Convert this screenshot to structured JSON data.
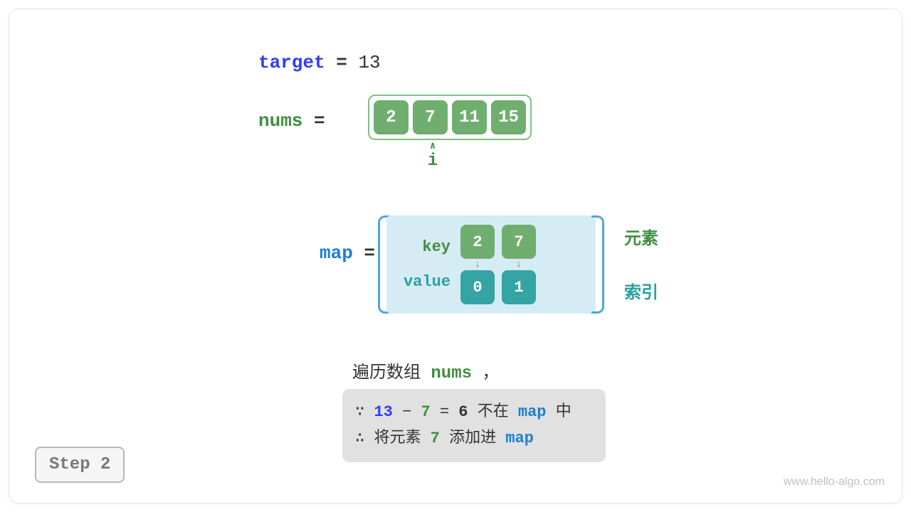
{
  "target": {
    "label": "target",
    "eq": "=",
    "value": "13"
  },
  "nums": {
    "label": "nums",
    "eq": "=",
    "items": [
      "2",
      "7",
      "11",
      "15"
    ],
    "pointer": {
      "index": 1,
      "symbol": "i"
    }
  },
  "map": {
    "label": "map",
    "eq": "=",
    "key_label": "key",
    "value_label": "value",
    "entries": [
      {
        "key": "2",
        "value": "0"
      },
      {
        "key": "7",
        "value": "1"
      }
    ],
    "side": {
      "key_desc": "元素",
      "value_desc": "索引"
    }
  },
  "desc": {
    "line1_pre": "遍历数组 ",
    "line1_var": "nums",
    "line1_post": " ，",
    "because": "∵",
    "therefore": "∴",
    "n1": "13",
    "minus": "−",
    "n2": "7",
    "eq": "=",
    "n3": "6",
    "notin_pre": " 不在 ",
    "map_word": "map",
    "notin_post": " 中",
    "add_pre": " 将元素 ",
    "add_num": "7",
    "add_mid": " 添加进 "
  },
  "step": {
    "label": "Step 2"
  },
  "watermark": "www.hello-algo.com"
}
